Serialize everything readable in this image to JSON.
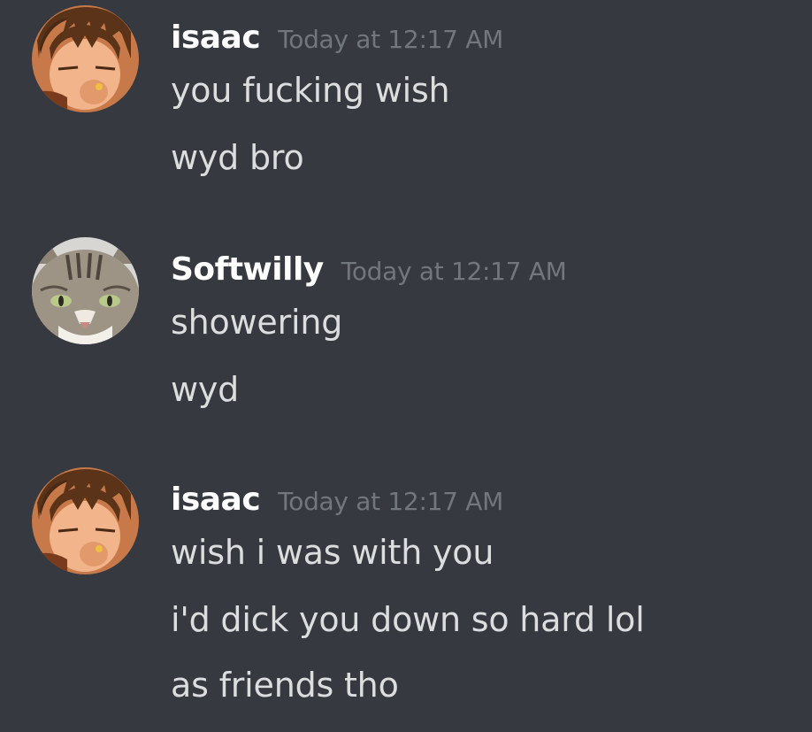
{
  "messages": [
    {
      "author": "isaac",
      "timestamp": "Today at 12:17 AM",
      "lines": [
        "you fucking wish",
        "wyd bro"
      ]
    },
    {
      "author": "Softwilly",
      "timestamp": "Today at 12:17 AM",
      "lines": [
        "showering",
        "wyd"
      ]
    },
    {
      "author": "isaac",
      "timestamp": "Today at 12:17 AM",
      "lines": [
        "wish i was with you",
        "i'd dick you down so hard lol",
        "as friends tho"
      ]
    }
  ],
  "colors": {
    "background": "#36393f",
    "username": "#ffffff",
    "timestamp": "#72767d",
    "message_text": "#dcddde"
  },
  "icons": {
    "isaac_avatar": "anime-character-avatar",
    "softwilly_avatar": "cat-avatar"
  }
}
